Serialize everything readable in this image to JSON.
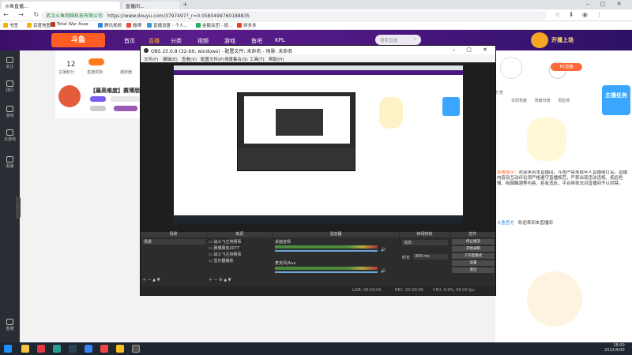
{
  "browser": {
    "tabs": [
      "斗鱼直播...",
      "直播间...",
      "+"
    ],
    "url_secure": "武汉斗鱼网络科技有限公司",
    "url": "https://www.douyu.com/3797497?_r=0.0580499760188835",
    "bookmarks": [
      "书签",
      "百度地图",
      "Total War Asse",
      "腾讯视频",
      "微博",
      "直播设置 - 个人...",
      "金额关团 - 提...",
      "拼多多"
    ]
  },
  "douyu": {
    "nav": [
      "首页",
      "直播",
      "分类",
      "视频",
      "游戏",
      "鱼吧",
      "KPL"
    ],
    "search_placeholder": "搜索直播",
    "user_btns": [
      "12",
      "主播积分",
      "直播奖励",
      "播放器"
    ],
    "room_title": "【最高难度】赛博朋",
    "sidebar": [
      "关注",
      "排行",
      "游戏",
      "云游戏",
      "看播",
      "客服"
    ],
    "right_tabs": [
      "主播打赏",
      "本周贡献",
      "贡献日榜",
      "周星榜"
    ],
    "chat_notice": "欢迎来到本直播间，斗鱼严禁未成年人直播或打赏。直播内容及互动评论须严格遵守直播规范，严禁出现违法违规、低俗色情、吸烟酗酒等内容，若有违反，平台将依法对直播间予以封禁。",
    "chat_user": "斗鱼官方",
    "chat_msg": "欢迎来到本直播间"
  },
  "obs": {
    "title": "OBS 25.0.8 (32-bit, windows) - 配置文件: 未命名 - 场景: 未命名",
    "menus": [
      "文件(F)",
      "编辑(E)",
      "查看(V)",
      "配置文件(P)",
      "场景集合(S)",
      "工具(T)",
      "帮助(H)"
    ],
    "panels": [
      "场景",
      "来源",
      "混音器",
      "转场特效",
      "控件"
    ],
    "scene": "场景",
    "sources": [
      "战斗飞主持赛事",
      "赛博朋克2077",
      "战斗飞主持赛事",
      "显示器捕获"
    ],
    "mixer": [
      "桌面音频",
      "麦克风/Aux"
    ],
    "transition": "淡出",
    "duration_label": "时长",
    "duration": "300 ms",
    "controls": [
      "停止推流",
      "开始录制",
      "工作室模式",
      "设置",
      "退出"
    ],
    "status": [
      "LIVE: 00:00:00",
      "REC: 00:00:00",
      "CPU: 0.9%, 60.00 fps"
    ]
  },
  "taskbar": {
    "time": "18:00",
    "date": "2022/4/30"
  }
}
